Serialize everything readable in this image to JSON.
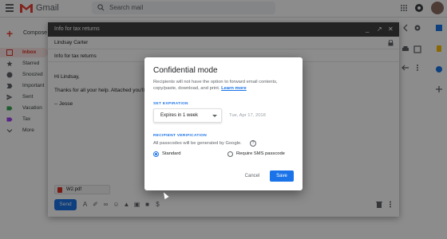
{
  "app": {
    "name": "Gmail"
  },
  "search": {
    "placeholder": "Search mail"
  },
  "compose_button": {
    "label": "Compose"
  },
  "nav": {
    "items": [
      {
        "label": "Inbox",
        "icon": "inbox-icon"
      },
      {
        "label": "Starred",
        "icon": "star-icon"
      },
      {
        "label": "Snoozed",
        "icon": "clock-icon"
      },
      {
        "label": "Important",
        "icon": "important-icon"
      },
      {
        "label": "Sent",
        "icon": "send-icon"
      },
      {
        "label": "Vacation",
        "icon": "label-icon"
      },
      {
        "label": "Tax",
        "icon": "label-icon"
      },
      {
        "label": "More",
        "icon": "chevron-down-icon"
      }
    ]
  },
  "compose_window": {
    "title": "Info for tax returns",
    "to": "Lindsay Carter",
    "subject": "Info for tax returns",
    "body": [
      "Hi Lindsay,",
      "Thanks for all your help. Attached you'll fin",
      "-- Jesse"
    ],
    "attachment": "W2.pdf",
    "send_label": "Send"
  },
  "dialog": {
    "title": "Confidential mode",
    "description": "Recipients will not have the option to forward email contents, copy/paste, download, and print.",
    "learn_more": "Learn more",
    "expiration_label": "SET EXPIRATION",
    "expiration_value": "Expires in 1 week",
    "expiration_date": "Tue, Apr 17, 2018",
    "verification_label": "RECIPIENT VERIFICATION",
    "verification_desc": "All passcodes will be generated by Google.",
    "verification_help": "?",
    "option_standard": "Standard",
    "option_sms": "Require SMS passcode",
    "selected_option": "Standard",
    "cancel_label": "Cancel",
    "save_label": "Save"
  },
  "colors": {
    "accent": "#1a73e8",
    "gmail_red": "#ea4335",
    "header_dark": "#404040"
  }
}
